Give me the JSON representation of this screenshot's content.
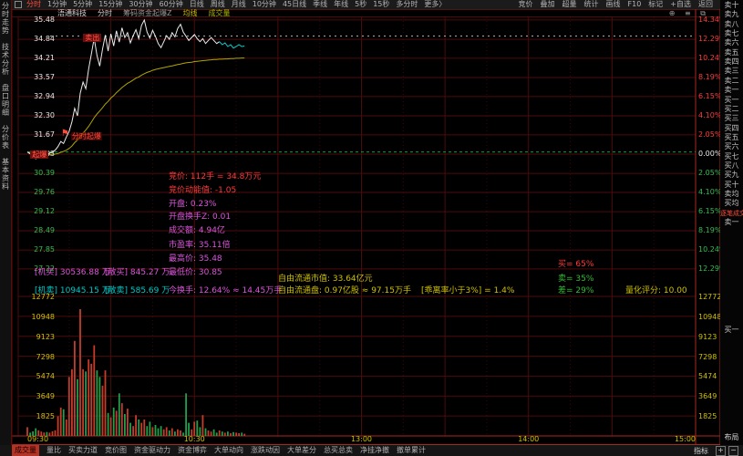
{
  "top_toolbar": {
    "periods": [
      "分时",
      "1分钟",
      "5分钟",
      "15分钟",
      "30分钟",
      "60分钟",
      "日线",
      "周线",
      "月线",
      "10分钟",
      "45日线",
      "季线",
      "年线",
      "5秒",
      "15秒",
      "多分时",
      "更多〉"
    ],
    "active_period": "分时",
    "right_items": [
      "竞价",
      "叠加",
      "超量",
      "统计",
      "画线",
      "F10",
      "标记",
      "+自选",
      "返回"
    ]
  },
  "title_bar": {
    "stock_name": "浯通科技",
    "period_label": "分时",
    "indicator_label": "筹码资金起爆Z",
    "ma_label": "均线",
    "volume_label": "成交量",
    "window_icons": "⊕ ≡ ⧉"
  },
  "left_tabs": [
    "分时走势",
    "技术分析",
    "盘口明细",
    "分价表",
    "基本资料"
  ],
  "axes": {
    "price_labels": [
      "35.48",
      "34.84",
      "34.21",
      "33.57",
      "32.94",
      "32.30",
      "31.67",
      "31.03",
      "30.39",
      "29.76",
      "29.12",
      "28.49",
      "27.85",
      "27.22"
    ],
    "pct_labels": [
      "14.34%",
      "12.29%",
      "10.24%",
      "8.19%",
      "6.15%",
      "4.10%",
      "2.05%",
      "0.00%",
      "2.05%",
      "4.10%",
      "6.15%",
      "8.19%",
      "10.24%",
      "12.29%"
    ],
    "volume_labels": [
      "12772",
      "10948",
      "9123",
      "7298",
      "5474",
      "3649",
      "1825"
    ],
    "time_labels": [
      "09:30",
      "10:30",
      "13:00",
      "14:00",
      "15:00"
    ]
  },
  "stats": [
    {
      "key": "jingjia",
      "text": "竞价: 112手 = 34.8万元",
      "color": "red"
    },
    {
      "key": "momentum",
      "text": "竞价动能值: -1.05",
      "color": "red"
    },
    {
      "key": "open",
      "text": "开盘: 0.23%",
      "color": "magenta"
    },
    {
      "key": "open_turnover",
      "text": "开盘换手Z: 0.01",
      "color": "magenta"
    },
    {
      "key": "amount",
      "text": "成交额: 4.94亿",
      "color": "magenta"
    },
    {
      "key": "pe",
      "text": "市盈率: 35.11倍",
      "color": "magenta"
    },
    {
      "key": "high",
      "text": "最高价: 35.48",
      "color": "magenta"
    },
    {
      "key": "low",
      "text": "最低价: 30.85",
      "color": "magenta"
    },
    {
      "key": "today_turnover",
      "text": "今换手: 12.64% ≈ 14.45万手",
      "color": "magenta"
    },
    {
      "key": "inst_buy",
      "text": "[机买] 30536.88 万",
      "color": "magenta"
    },
    {
      "key": "retail_buy",
      "text": "[散买] 845.27 万",
      "color": "magenta"
    },
    {
      "key": "inst_sell",
      "text": "[机卖] 10945.15 万",
      "color": "cyan"
    },
    {
      "key": "retail_sell",
      "text": "[散卖] 585.69 万",
      "color": "cyan"
    },
    {
      "key": "free_mktcap",
      "text": "自由流通市值: 33.64亿元",
      "color": "yellow"
    },
    {
      "key": "free_float",
      "text": "自由流通盘: 0.97亿股 ≈ 97.15万手",
      "color": "yellow"
    },
    {
      "key": "bias",
      "text": "[乖离率小于3%] = 1.4%",
      "color": "yellow"
    },
    {
      "key": "buy_pct",
      "text": "买= 65%",
      "color": "red"
    },
    {
      "key": "sell_pct",
      "text": "卖= 35%",
      "color": "green"
    },
    {
      "key": "diff_pct",
      "text": "差= 29%",
      "color": "green"
    },
    {
      "key": "score",
      "text": "量化评分: 10.00",
      "color": "yellow"
    }
  ],
  "chart_data": {
    "type": "line",
    "subtype": "intraday price/average with volume bars",
    "preclose": 31.03,
    "session_minutes": 240,
    "price_axis_range": [
      27.22,
      35.48
    ],
    "pct_axis_range": [
      -12.29,
      14.34
    ],
    "volume_axis_max": 12772,
    "time_labels": [
      "09:30",
      "10:30",
      "13:00",
      "14:00",
      "15:00"
    ],
    "price": [
      31.1,
      31.04,
      30.95,
      30.88,
      30.92,
      31.0,
      31.05,
      31.02,
      31.06,
      31.1,
      31.16,
      31.28,
      31.45,
      31.38,
      31.6,
      31.78,
      32.1,
      32.55,
      32.3,
      33.05,
      33.42,
      33.2,
      33.85,
      34.35,
      34.88,
      34.3,
      33.95,
      34.52,
      34.98,
      34.45,
      35.02,
      34.62,
      35.12,
      34.75,
      35.22,
      34.9,
      35.06,
      34.72,
      34.96,
      35.16,
      34.86,
      35.3,
      35.48,
      35.08,
      34.88,
      35.14,
      34.94,
      34.7,
      34.56,
      34.76,
      34.96,
      34.84,
      35.06,
      34.92,
      35.2,
      35.34,
      35.08,
      34.94,
      34.8,
      34.9,
      35.0,
      34.86,
      34.76,
      34.86,
      34.7,
      34.8,
      34.9,
      34.8,
      34.7,
      34.76,
      34.66,
      34.72,
      34.6,
      34.66,
      34.55,
      34.6,
      34.66,
      34.6,
      34.62
    ],
    "average": [
      31.1,
      31.07,
      31.03,
      31.0,
      30.99,
      30.99,
      31.0,
      31.0,
      31.01,
      31.02,
      31.03,
      31.05,
      31.09,
      31.12,
      31.16,
      31.22,
      31.3,
      31.41,
      31.5,
      31.61,
      31.73,
      31.83,
      31.95,
      32.09,
      32.24,
      32.36,
      32.46,
      32.57,
      32.69,
      32.78,
      32.89,
      32.97,
      33.07,
      33.15,
      33.24,
      33.31,
      33.38,
      33.43,
      33.49,
      33.55,
      33.59,
      33.65,
      33.7,
      33.74,
      33.77,
      33.81,
      33.84,
      33.86,
      33.88,
      33.9,
      33.92,
      33.94,
      33.96,
      33.98,
      34.0,
      34.02,
      34.04,
      34.06,
      34.07,
      34.08,
      34.1,
      34.11,
      34.12,
      34.13,
      34.14,
      34.15,
      34.16,
      34.17,
      34.17,
      34.18,
      34.18,
      34.19,
      34.19,
      34.2,
      34.2,
      34.21,
      34.21,
      34.22,
      34.22
    ],
    "volume": [
      800,
      300,
      420,
      700,
      520,
      400,
      320,
      360,
      300,
      420,
      520,
      1800,
      2600,
      2450,
      1500,
      5400,
      6100,
      8700,
      5200,
      11600,
      6100,
      5900,
      7000,
      6600,
      8300,
      6000,
      5400,
      4600,
      6000,
      2100,
      1700,
      2600,
      2300,
      3900,
      3000,
      2000,
      2500,
      1200,
      900,
      1900,
      1500,
      1200,
      1500,
      900,
      1300,
      800,
      1000,
      700,
      900,
      600,
      800,
      500,
      700,
      400,
      600,
      500,
      300,
      3900,
      1200,
      600,
      1300,
      1400,
      800,
      1900,
      700,
      500,
      400,
      600,
      300,
      500,
      400,
      300,
      400,
      250,
      350,
      300,
      250,
      300,
      200
    ],
    "recent_segment_start": 69,
    "ref_lines": {
      "dash_white_price": 34.95,
      "dash_green_price": 31.1
    },
    "markers": [
      {
        "key": "sell",
        "label": "卖出",
        "minute": 24,
        "price": 34.88,
        "style": "box"
      },
      {
        "key": "breakout",
        "label": "分时起爆",
        "minute": 16,
        "price": 31.62,
        "style": "flag"
      },
      {
        "key": "start",
        "label": "起爆",
        "minute": 5,
        "price": 31.0,
        "style": "box"
      }
    ]
  },
  "right_panel": {
    "rows": [
      "卖十",
      "卖九",
      "卖八",
      "卖七",
      "卖六",
      "卖五",
      "卖四",
      "卖三",
      "卖二",
      "卖一",
      "买一",
      "买二",
      "买三",
      "买四",
      "买五",
      "买六",
      "买七",
      "买八",
      "买九",
      "买十",
      "卖均",
      "买均",
      "逐笔成交",
      "卖一"
    ],
    "mid_label": "买一",
    "layout_label": "布局",
    "zoom_in": "+",
    "zoom_out": "−"
  },
  "bottom_toolbar": {
    "items": [
      "成交量",
      "量比",
      "买卖力道",
      "竞价图",
      "资金驱动力",
      "资金博弈",
      "大单动向",
      "涨跌动因",
      "大单差分",
      "总买总卖",
      "净挂净撤",
      "撤单累计"
    ],
    "active": "成交量",
    "indicator_label": "指标",
    "plus": "+",
    "minus": "−"
  },
  "colors": {
    "up": "#c43c2a",
    "down": "#1fa14a",
    "red": "#ff3a3a",
    "magenta": "#dd55dd",
    "cyan": "#00c8c8",
    "yellow": "#cfc000",
    "green": "#33bb33",
    "price_line": "#ececec",
    "recent_line": "#00d2d2",
    "avg_line": "#b0a400",
    "grid": "#4d0b0b",
    "border": "#a8271e"
  }
}
